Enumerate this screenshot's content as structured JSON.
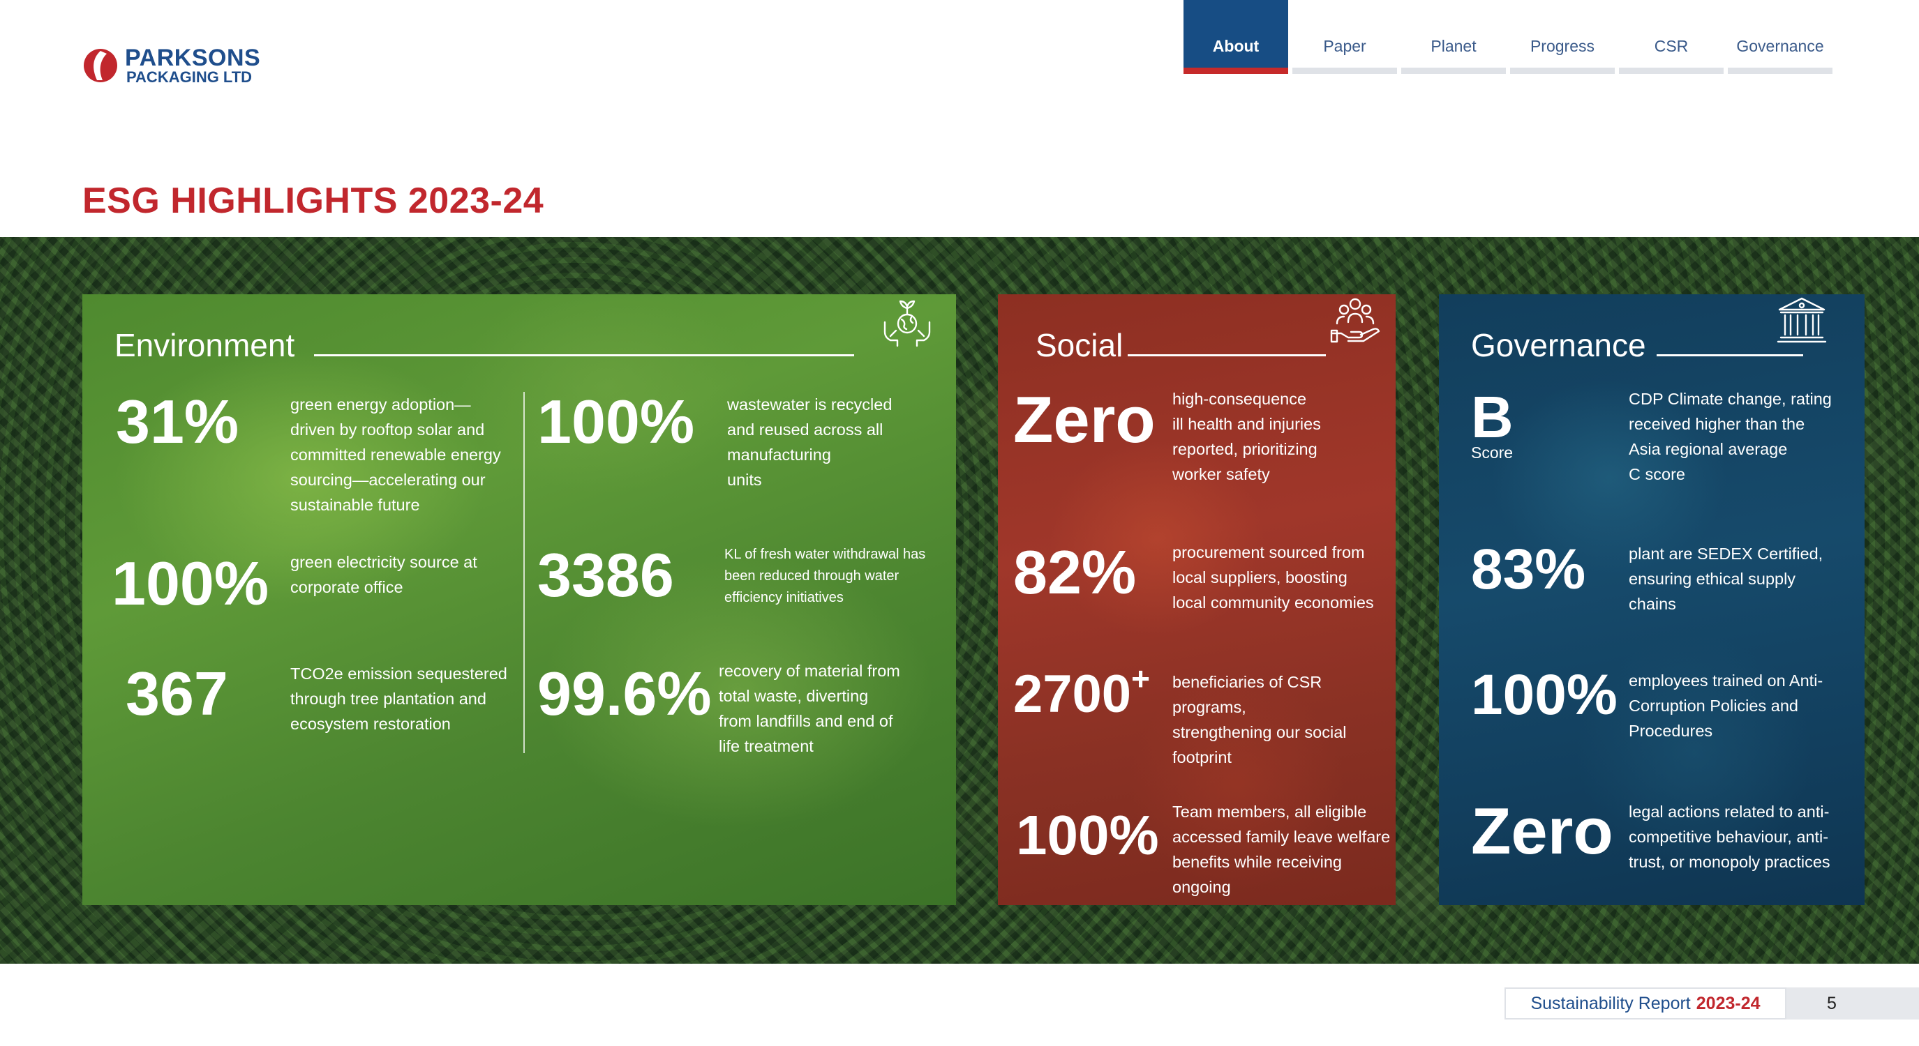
{
  "brand": {
    "name_line1": "PARKSONS",
    "name_line2": "PACKAGING LTD",
    "brand_color": "#1f4e8c",
    "logo_mark_color": "#c1272d"
  },
  "nav": {
    "tabs": [
      {
        "label": "About",
        "active": true
      },
      {
        "label": "Paper",
        "active": false
      },
      {
        "label": "Planet",
        "active": false
      },
      {
        "label": "Progress",
        "active": false
      },
      {
        "label": "CSR",
        "active": false
      },
      {
        "label": "Governance",
        "active": false
      }
    ],
    "active_color": "#174d84",
    "active_underline_color": "#c62a2a"
  },
  "heading": "ESG HIGHLIGHTS 2023-24",
  "environment": {
    "title": "Environment",
    "icon": "plant-globe-hands-icon",
    "stats": [
      {
        "value": "31%",
        "desc": "green energy adoption—\ndriven by rooftop solar and\ncommitted renewable energy\nsourcing—accelerating our\nsustainable future"
      },
      {
        "value": "100%",
        "desc": "green electricity source at\ncorporate office"
      },
      {
        "value": "367",
        "desc": "TCO2e emission sequestered\nthrough tree plantation and\necosystem restoration"
      },
      {
        "value": "100%",
        "desc": "wastewater is recycled\nand reused across all\nmanufacturing\nunits"
      },
      {
        "value": "3386",
        "desc": "KL of fresh water withdrawal has\nbeen reduced through water\nefficiency initiatives"
      },
      {
        "value": "99.6%",
        "desc": "recovery of material from\ntotal waste, diverting\nfrom landfills and end of\nlife treatment"
      }
    ]
  },
  "social": {
    "title": "Social",
    "icon": "community-hand-icon",
    "stats": [
      {
        "value": "Zero",
        "desc": "high-consequence\nill health and injuries\nreported, prioritizing\nworker safety"
      },
      {
        "value": "82%",
        "desc": "procurement sourced from\nlocal suppliers, boosting\nlocal community economies"
      },
      {
        "value": "2700",
        "sup": "+",
        "desc": "beneficiaries of CSR programs,\nstrengthening our social\nfootprint"
      },
      {
        "value": "100%",
        "desc": "Team members, all eligible\naccessed family leave welfare\nbenefits while receiving ongoing\ncareer development support"
      }
    ]
  },
  "governance": {
    "title": "Governance",
    "icon": "institution-building-icon",
    "stats": [
      {
        "value": "B",
        "sub": "Score",
        "desc": "CDP Climate change, rating\nreceived higher than the\nAsia regional average\nC score"
      },
      {
        "value": "83%",
        "desc": "plant are SEDEX Certified,\nensuring ethical supply\nchains"
      },
      {
        "value": "100%",
        "desc": "employees trained on Anti-\nCorruption Policies and\nProcedures"
      },
      {
        "value": "Zero",
        "desc": "legal actions related to anti-\ncompetitive behaviour, anti-\ntrust, or monopoly practices"
      }
    ]
  },
  "footer": {
    "report_label": "Sustainability Report",
    "report_year": "2023-24",
    "page_number": "5"
  }
}
